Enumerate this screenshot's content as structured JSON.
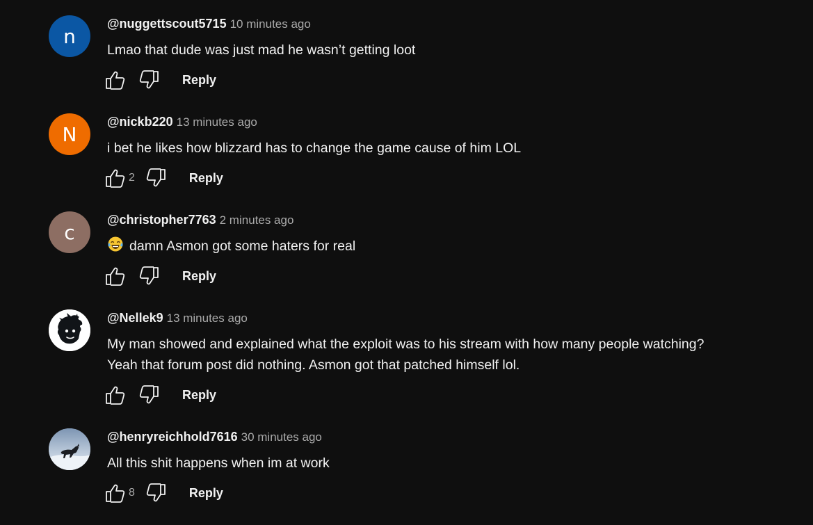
{
  "comments": [
    {
      "author": "@nuggettscout5715",
      "time": "10 minutes ago",
      "lines": [
        "Lmao that dude was just mad he wasn’t getting loot"
      ],
      "likes": "",
      "avatar": {
        "type": "letter",
        "letter": "n",
        "color": "#0b57a4"
      },
      "reply_label": "Reply",
      "emoji": ""
    },
    {
      "author": "@nickb220",
      "time": "13 minutes ago",
      "lines": [
        "i bet he likes how blizzard has to change the game cause of him LOL"
      ],
      "likes": "2",
      "avatar": {
        "type": "letter",
        "letter": "N",
        "color": "#ef6c00"
      },
      "reply_label": "Reply",
      "emoji": ""
    },
    {
      "author": "@christopher7763",
      "time": "2 minutes ago",
      "lines": [
        "damn Asmon got some haters for real"
      ],
      "likes": "",
      "avatar": {
        "type": "letter",
        "letter": "c",
        "color": "#8d6e63"
      },
      "reply_label": "Reply",
      "emoji": "tears-of-joy-emoji"
    },
    {
      "author": "@Nellek9",
      "time": "13 minutes ago",
      "lines": [
        "My man showed and explained what the exploit was to his stream with how many people watching?",
        "Yeah that forum post did nothing. Asmon got that patched himself lol."
      ],
      "likes": "",
      "avatar": {
        "type": "image",
        "icon": "cartoon-character-avatar"
      },
      "reply_label": "Reply",
      "emoji": ""
    },
    {
      "author": "@henryreichhold7616",
      "time": "30 minutes ago",
      "lines": [
        "All this shit happens when im at work"
      ],
      "likes": "8",
      "avatar": {
        "type": "image",
        "icon": "dog-in-snow-avatar"
      },
      "reply_label": "Reply",
      "emoji": ""
    }
  ],
  "icons": {
    "like": "thumbs-up-icon",
    "dislike": "thumbs-down-icon"
  },
  "colors": {
    "background": "#0f0f0f",
    "primary_text": "#f1f1f1",
    "secondary_text": "#aaaaaa"
  }
}
